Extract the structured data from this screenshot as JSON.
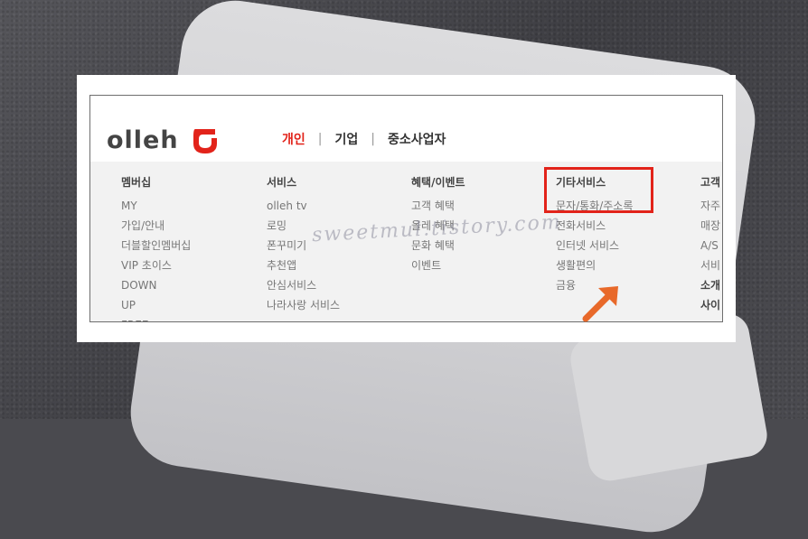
{
  "brand": {
    "logo_text": "olleh",
    "colors": {
      "accent": "#e2231a",
      "arrow": "#e8692a"
    }
  },
  "nav": {
    "items": [
      {
        "label": "개인",
        "active": true
      },
      {
        "label": "기업",
        "active": false
      },
      {
        "label": "중소사업자",
        "active": false
      }
    ]
  },
  "menu": {
    "columns": [
      {
        "head": "멤버십",
        "links": [
          "MY",
          "가입/안내",
          "더블할인멤버십",
          "VIP 초이스",
          "DOWN",
          "UP",
          "FREE"
        ]
      },
      {
        "head": "서비스",
        "links": [
          "olleh tv",
          "로밍",
          "폰꾸미기",
          "추천앱",
          "안심서비스",
          "나라사랑 서비스"
        ]
      },
      {
        "head": "혜택/이벤트",
        "links": [
          "고객 혜택",
          "올레 혜택",
          "문화 혜택",
          "이벤트"
        ]
      },
      {
        "head": "기타서비스",
        "links": [
          "문자/통화/주소록",
          "전화서비스",
          "인터넷 서비스",
          "생활편의",
          "금융"
        ]
      },
      {
        "head": "고객",
        "links": [
          "자주",
          "매장",
          "A/S",
          "서비"
        ],
        "sub_heads": [
          "소개",
          "사이"
        ]
      }
    ]
  },
  "watermark": "sweetmul.tistory.com",
  "icons": {
    "logo": "olleh-logo-icon",
    "arrow": "arrow-up-right-icon"
  }
}
